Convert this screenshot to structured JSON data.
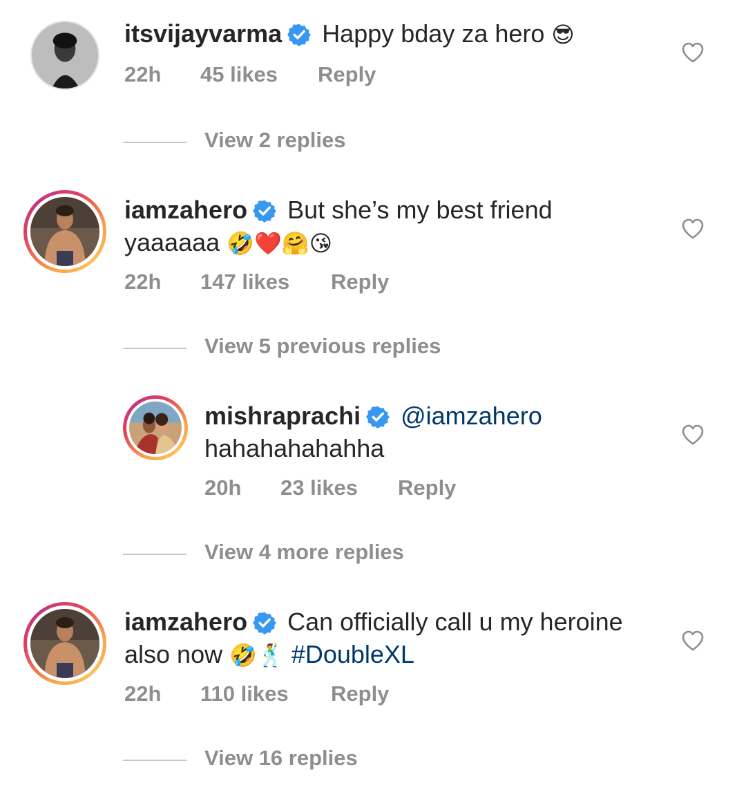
{
  "comments": [
    {
      "username": "itsvijayvarma",
      "text": "Happy bday za hero",
      "emoji": "😎",
      "time": "22h",
      "likes": "45 likes",
      "reply_label": "Reply"
    },
    {
      "username": "iamzahero",
      "text": "But she’s my best friend",
      "text_line2": "yaaaaaa",
      "emoji": "🤣❤️🤗😘",
      "time": "22h",
      "likes": "147 likes",
      "reply_label": "Reply"
    },
    {
      "username": "mishraprachi",
      "mention": "@iamzahero",
      "text_line2": "hahahahahahha",
      "time": "20h",
      "likes": "23 likes",
      "reply_label": "Reply"
    },
    {
      "username": "iamzahero",
      "text": "Can officially call u my heroine",
      "text_line2": "also now",
      "emoji": "🤣🕺",
      "hashtag": "#DoubleXL",
      "time": "22h",
      "likes": "110 likes",
      "reply_label": "Reply"
    }
  ],
  "view_replies": [
    "View 2 replies",
    "View 5 previous replies",
    "View 4 more replies",
    "View 16 replies"
  ],
  "colors": {
    "text": "#262626",
    "secondary": "#8e8e8e",
    "link": "#00376b",
    "verified": "#3897f0"
  },
  "icons": {
    "verified": "verified-badge-icon",
    "like": "heart-outline-icon"
  }
}
